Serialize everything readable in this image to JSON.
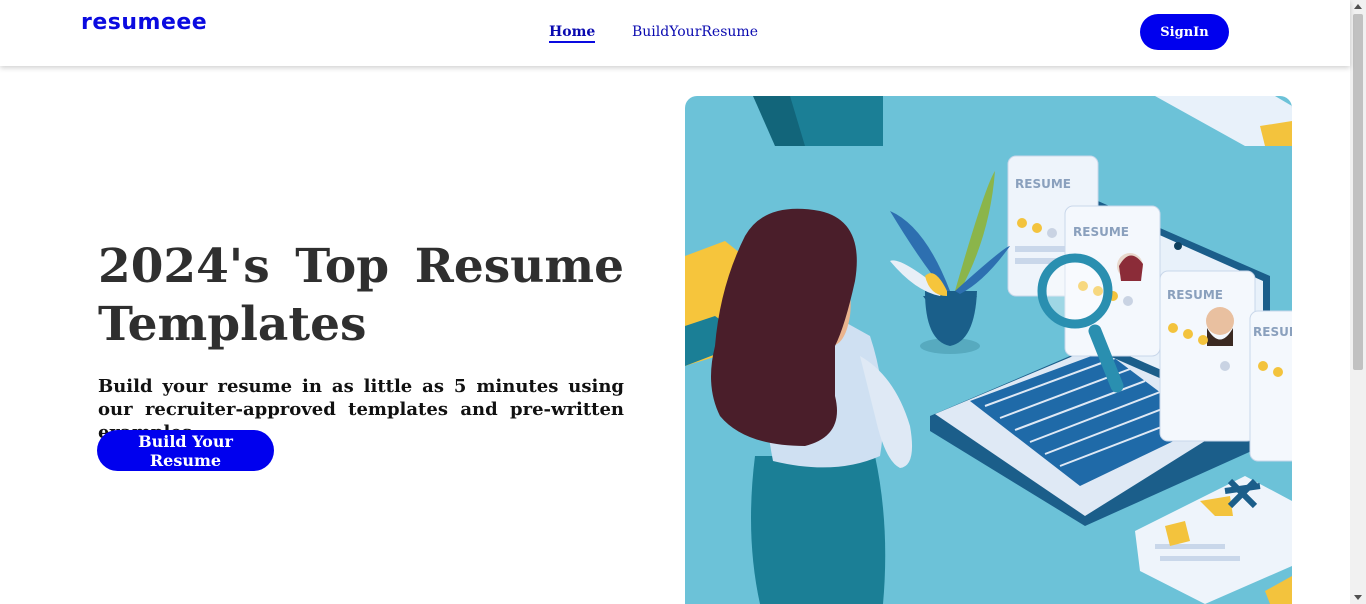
{
  "brand": {
    "logo": "resumeee"
  },
  "nav": {
    "home": "Home",
    "build": "BuildYourResume",
    "signin": "SignIn"
  },
  "hero": {
    "title": "2024's Top Resume Templates",
    "subtitle": "Build your resume in as little as 5 minutes using our recruiter-approved templates and pre-written examples.",
    "cta": "Build Your Resume"
  },
  "illustration": {
    "card_labels": [
      "RESUME",
      "RESUME",
      "RESUME",
      "RESUME"
    ]
  },
  "colors": {
    "accent": "#0000ee",
    "illustration_bg": "#6cc2d8"
  }
}
